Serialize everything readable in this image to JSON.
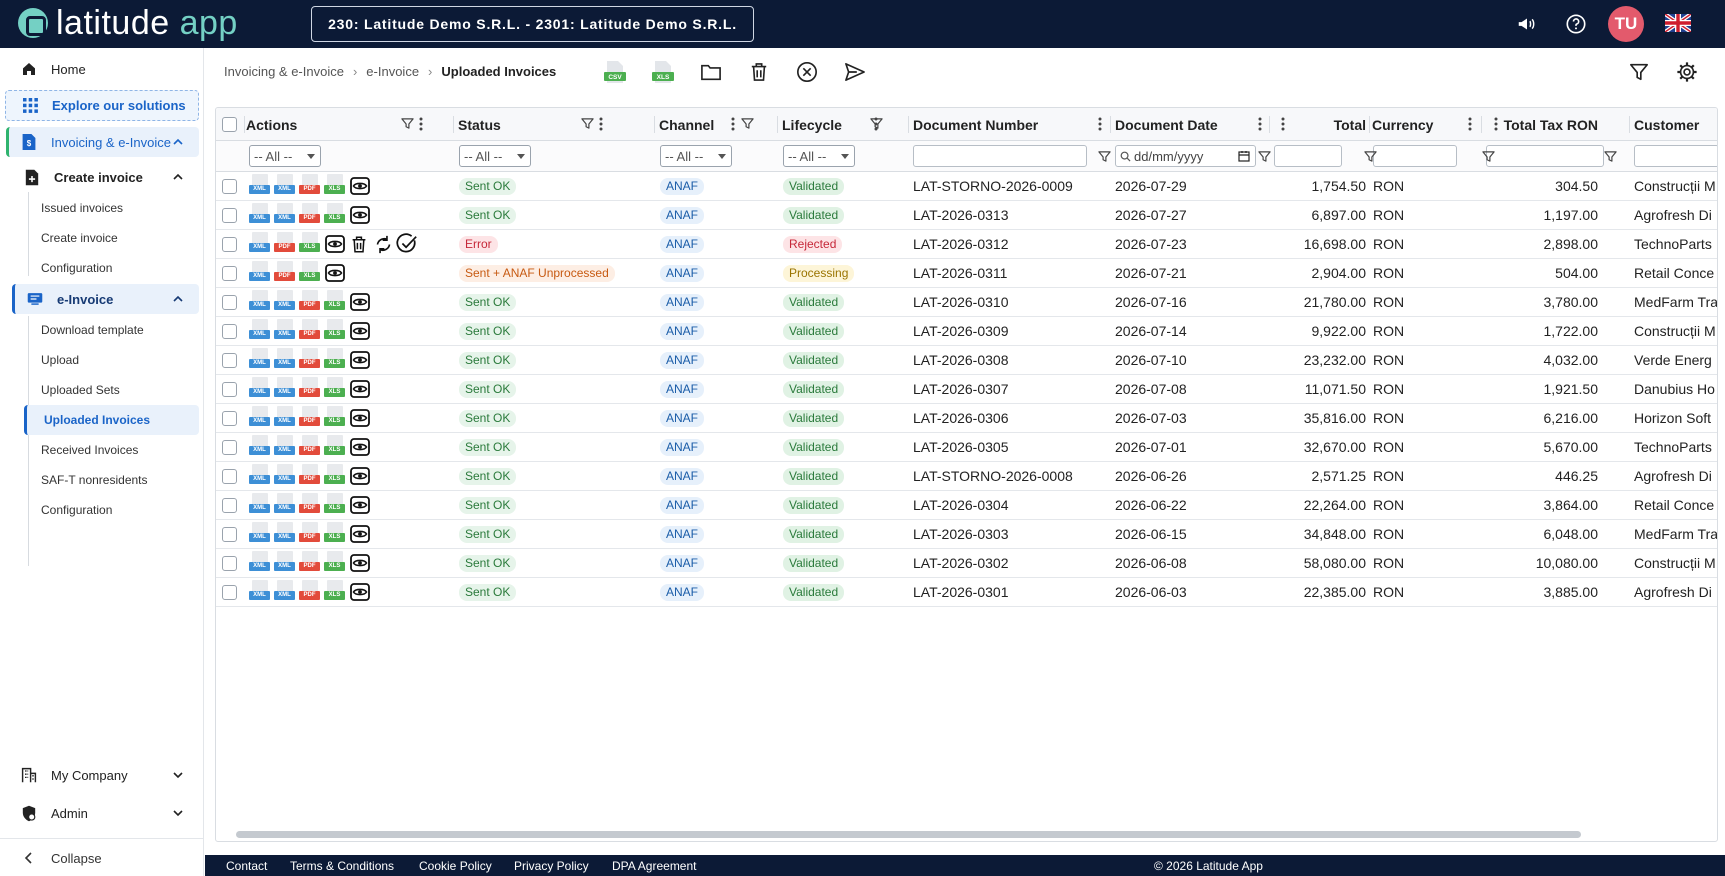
{
  "app": {
    "logo_text_a": "latitude",
    "logo_text_b": " app",
    "company": "230: Latitude Demo S.R.L. - 2301: Latitude Demo S.R.L.",
    "avatar": "TU"
  },
  "sidebar": {
    "home": "Home",
    "explore": "Explore our solutions",
    "invoicing": "Invoicing & e-Invoice",
    "create_group": "Create invoice",
    "create_items": [
      "Issued invoices",
      "Create invoice",
      "Configuration"
    ],
    "einvoice": "e-Invoice",
    "einvoice_items": [
      "Download template",
      "Upload",
      "Uploaded Sets",
      "Uploaded Invoices",
      "Received Invoices",
      "SAF-T nonresidents",
      "Configuration"
    ],
    "my_company": "My Company",
    "admin": "Admin",
    "collapse": "Collapse"
  },
  "breadcrumb": {
    "a": "Invoicing & e-Invoice",
    "b": "e-Invoice",
    "current": "Uploaded Invoices"
  },
  "toolbar": {
    "csv": "CSV",
    "xls": "XLS"
  },
  "columns": {
    "actions": "Actions",
    "status": "Status",
    "channel": "Channel",
    "lifecycle": "Lifecycle",
    "doc_number": "Document Number",
    "doc_date": "Document Date",
    "total": "Total",
    "currency": "Currency",
    "total_tax": "Total Tax RON",
    "customer": "Customer"
  },
  "filters": {
    "all": "-- All --",
    "date_placeholder": "dd/mm/yyyy"
  },
  "rows": [
    {
      "actions": [
        "XML",
        "XML",
        "PDF",
        "XLS",
        "view"
      ],
      "status": "Sent OK",
      "status_type": "ok",
      "channel": "ANAF",
      "lifecycle": "Validated",
      "lc_type": "valid",
      "doc": "LAT-STORNO-2026-0009",
      "date": "2026-07-29",
      "total": "1,754.50",
      "currency": "RON",
      "tax": "304.50",
      "customer": "Construcții M"
    },
    {
      "actions": [
        "XML",
        "XML",
        "PDF",
        "XLS",
        "view"
      ],
      "status": "Sent OK",
      "status_type": "ok",
      "channel": "ANAF",
      "lifecycle": "Validated",
      "lc_type": "valid",
      "doc": "LAT-2026-0313",
      "date": "2026-07-27",
      "total": "6,897.00",
      "currency": "RON",
      "tax": "1,197.00",
      "customer": "Agrofresh Di"
    },
    {
      "actions": [
        "XML",
        "PDF",
        "XLS",
        "view",
        "delete",
        "retry",
        "validate"
      ],
      "status": "Error",
      "status_type": "err",
      "channel": "ANAF",
      "lifecycle": "Rejected",
      "lc_type": "reject",
      "doc": "LAT-2026-0312",
      "date": "2026-07-23",
      "total": "16,698.00",
      "currency": "RON",
      "tax": "2,898.00",
      "customer": "TechnoParts"
    },
    {
      "actions": [
        "XML",
        "PDF",
        "XLS",
        "view"
      ],
      "status": "Sent + ANAF Unprocessed",
      "status_type": "warn",
      "channel": "ANAF",
      "lifecycle": "Processing",
      "lc_type": "proc",
      "doc": "LAT-2026-0311",
      "date": "2026-07-21",
      "total": "2,904.00",
      "currency": "RON",
      "tax": "504.00",
      "customer": "Retail Conce"
    },
    {
      "actions": [
        "XML",
        "XML",
        "PDF",
        "XLS",
        "view"
      ],
      "status": "Sent OK",
      "status_type": "ok",
      "channel": "ANAF",
      "lifecycle": "Validated",
      "lc_type": "valid",
      "doc": "LAT-2026-0310",
      "date": "2026-07-16",
      "total": "21,780.00",
      "currency": "RON",
      "tax": "3,780.00",
      "customer": "MedFarm Tra"
    },
    {
      "actions": [
        "XML",
        "XML",
        "PDF",
        "XLS",
        "view"
      ],
      "status": "Sent OK",
      "status_type": "ok",
      "channel": "ANAF",
      "lifecycle": "Validated",
      "lc_type": "valid",
      "doc": "LAT-2026-0309",
      "date": "2026-07-14",
      "total": "9,922.00",
      "currency": "RON",
      "tax": "1,722.00",
      "customer": "Construcții M"
    },
    {
      "actions": [
        "XML",
        "XML",
        "PDF",
        "XLS",
        "view"
      ],
      "status": "Sent OK",
      "status_type": "ok",
      "channel": "ANAF",
      "lifecycle": "Validated",
      "lc_type": "valid",
      "doc": "LAT-2026-0308",
      "date": "2026-07-10",
      "total": "23,232.00",
      "currency": "RON",
      "tax": "4,032.00",
      "customer": "Verde Energ"
    },
    {
      "actions": [
        "XML",
        "XML",
        "PDF",
        "XLS",
        "view"
      ],
      "status": "Sent OK",
      "status_type": "ok",
      "channel": "ANAF",
      "lifecycle": "Validated",
      "lc_type": "valid",
      "doc": "LAT-2026-0307",
      "date": "2026-07-08",
      "total": "11,071.50",
      "currency": "RON",
      "tax": "1,921.50",
      "customer": "Danubius Ho"
    },
    {
      "actions": [
        "XML",
        "XML",
        "PDF",
        "XLS",
        "view"
      ],
      "status": "Sent OK",
      "status_type": "ok",
      "channel": "ANAF",
      "lifecycle": "Validated",
      "lc_type": "valid",
      "doc": "LAT-2026-0306",
      "date": "2026-07-03",
      "total": "35,816.00",
      "currency": "RON",
      "tax": "6,216.00",
      "customer": "Horizon Soft"
    },
    {
      "actions": [
        "XML",
        "XML",
        "PDF",
        "XLS",
        "view"
      ],
      "status": "Sent OK",
      "status_type": "ok",
      "channel": "ANAF",
      "lifecycle": "Validated",
      "lc_type": "valid",
      "doc": "LAT-2026-0305",
      "date": "2026-07-01",
      "total": "32,670.00",
      "currency": "RON",
      "tax": "5,670.00",
      "customer": "TechnoParts"
    },
    {
      "actions": [
        "XML",
        "XML",
        "PDF",
        "XLS",
        "view"
      ],
      "status": "Sent OK",
      "status_type": "ok",
      "channel": "ANAF",
      "lifecycle": "Validated",
      "lc_type": "valid",
      "doc": "LAT-STORNO-2026-0008",
      "date": "2026-06-26",
      "total": "2,571.25",
      "currency": "RON",
      "tax": "446.25",
      "customer": "Agrofresh Di"
    },
    {
      "actions": [
        "XML",
        "XML",
        "PDF",
        "XLS",
        "view"
      ],
      "status": "Sent OK",
      "status_type": "ok",
      "channel": "ANAF",
      "lifecycle": "Validated",
      "lc_type": "valid",
      "doc": "LAT-2026-0304",
      "date": "2026-06-22",
      "total": "22,264.00",
      "currency": "RON",
      "tax": "3,864.00",
      "customer": "Retail Conce"
    },
    {
      "actions": [
        "XML",
        "XML",
        "PDF",
        "XLS",
        "view"
      ],
      "status": "Sent OK",
      "status_type": "ok",
      "channel": "ANAF",
      "lifecycle": "Validated",
      "lc_type": "valid",
      "doc": "LAT-2026-0303",
      "date": "2026-06-15",
      "total": "34,848.00",
      "currency": "RON",
      "tax": "6,048.00",
      "customer": "MedFarm Tra"
    },
    {
      "actions": [
        "XML",
        "XML",
        "PDF",
        "XLS",
        "view"
      ],
      "status": "Sent OK",
      "status_type": "ok",
      "channel": "ANAF",
      "lifecycle": "Validated",
      "lc_type": "valid",
      "doc": "LAT-2026-0302",
      "date": "2026-06-08",
      "total": "58,080.00",
      "currency": "RON",
      "tax": "10,080.00",
      "customer": "Construcții M"
    },
    {
      "actions": [
        "XML",
        "XML",
        "PDF",
        "XLS",
        "view"
      ],
      "status": "Sent OK",
      "status_type": "ok",
      "channel": "ANAF",
      "lifecycle": "Validated",
      "lc_type": "valid",
      "doc": "LAT-2026-0301",
      "date": "2026-06-03",
      "total": "22,385.00",
      "currency": "RON",
      "tax": "3,885.00",
      "customer": "Agrofresh Di"
    }
  ],
  "footer": {
    "contact": "Contact",
    "terms": "Terms & Conditions",
    "cookie": "Cookie Policy",
    "privacy": "Privacy Policy",
    "dpa": "DPA Agreement",
    "copyright": "© 2026 Latitude App"
  },
  "colors": {
    "navy": "#0c1a36",
    "accent": "#1a64c8",
    "teal": "#74d0c4",
    "avatar": "#e35a6c"
  }
}
